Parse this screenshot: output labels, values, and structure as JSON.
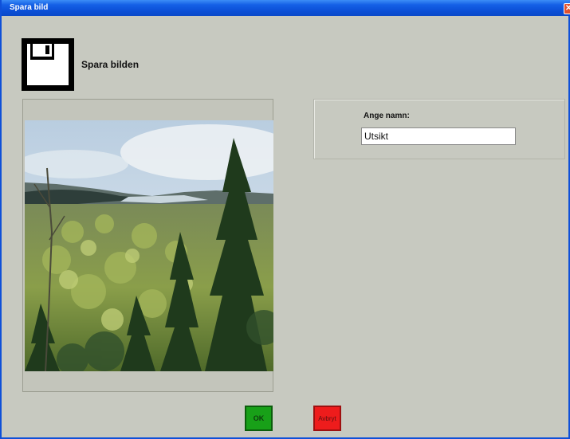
{
  "window": {
    "title": "Spara bild",
    "close_glyph": "✕"
  },
  "header": {
    "icon": "floppy-disk-icon",
    "title": "Spara bilden"
  },
  "preview": {
    "description_icon": "landscape-image"
  },
  "name_panel": {
    "label": "Ange namn:",
    "input_value": "Utsikt"
  },
  "buttons": {
    "ok_label": "OK",
    "cancel_label": "Avbryt"
  },
  "colors": {
    "titlebar": "#0b4fd6",
    "window_bg": "#c7c9c0",
    "ok_green": "#18a018",
    "cancel_red": "#ee1c1c"
  }
}
